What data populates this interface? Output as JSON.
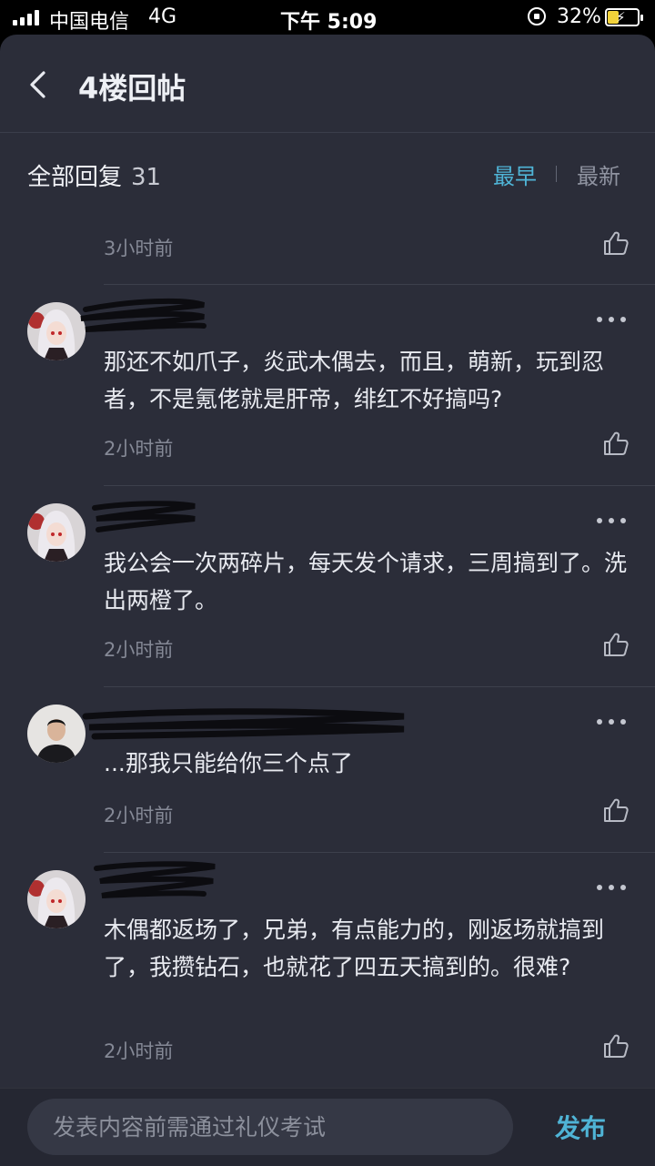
{
  "status_bar": {
    "carrier": "中国电信",
    "network": "4G",
    "time": "下午 5:09",
    "battery": "32%"
  },
  "header": {
    "title": "4楼回帖"
  },
  "replies_header": {
    "label": "全部回复",
    "count": "31",
    "sort_earliest": "最早",
    "sort_latest": "最新"
  },
  "top_item": {
    "time": "3小时前"
  },
  "replies": [
    {
      "content": "那还不如爪子，炎武木偶去，而且，萌新，玩到忍者，不是氪佬就是肝帝，绯红不好搞吗?",
      "time": "2小时前"
    },
    {
      "content": "我公会一次两碎片，每天发个请求，三周搞到了。洗出两橙了。",
      "time": "2小时前"
    },
    {
      "content": "...那我只能给你三个点了",
      "time": "2小时前"
    },
    {
      "content": "木偶都返场了，兄弟，有点能力的，刚返场就搞到了，我攒钻石，也就花了四五天搞到的。很难?",
      "time": "2小时前"
    }
  ],
  "composer": {
    "placeholder": "发表内容前需通过礼仪考试",
    "publish_label": "发布"
  },
  "colors": {
    "accent": "#4fb4d6",
    "background": "#2b2d39"
  }
}
